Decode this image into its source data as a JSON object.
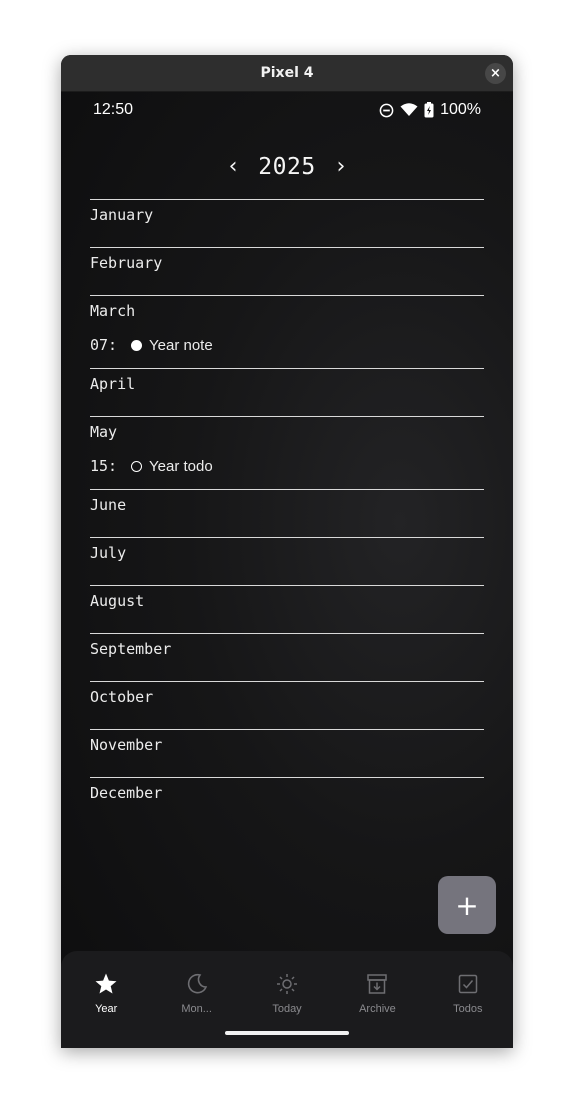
{
  "window": {
    "title": "Pixel 4",
    "close_label": "×"
  },
  "statusbar": {
    "time": "12:50",
    "battery": "100%"
  },
  "year_nav": {
    "prev_label": "‹",
    "year": "2025",
    "next_label": "›"
  },
  "months": [
    {
      "name": "January",
      "entries": []
    },
    {
      "name": "February",
      "entries": []
    },
    {
      "name": "March",
      "entries": [
        {
          "day": "07:",
          "kind": "note",
          "text": "Year note"
        }
      ]
    },
    {
      "name": "April",
      "entries": []
    },
    {
      "name": "May",
      "entries": [
        {
          "day": "15:",
          "kind": "todo",
          "text": "Year todo"
        }
      ]
    },
    {
      "name": "June",
      "entries": []
    },
    {
      "name": "July",
      "entries": []
    },
    {
      "name": "August",
      "entries": []
    },
    {
      "name": "September",
      "entries": []
    },
    {
      "name": "October",
      "entries": []
    },
    {
      "name": "November",
      "entries": []
    },
    {
      "name": "December",
      "entries": []
    }
  ],
  "fab": {
    "label": "+"
  },
  "bottom_nav": {
    "items": [
      {
        "label": "Year",
        "icon": "star-icon",
        "active": true
      },
      {
        "label": "Mon...",
        "icon": "moon-icon",
        "active": false
      },
      {
        "label": "Today",
        "icon": "sun-icon",
        "active": false
      },
      {
        "label": "Archive",
        "icon": "archive-icon",
        "active": false
      },
      {
        "label": "Todos",
        "icon": "checkbox-icon",
        "active": false
      }
    ]
  },
  "colors": {
    "background": "#0f0f10",
    "fab": "#75747d",
    "nav_bar": "#1b1b1d",
    "inactive": "#8a8a8e"
  }
}
